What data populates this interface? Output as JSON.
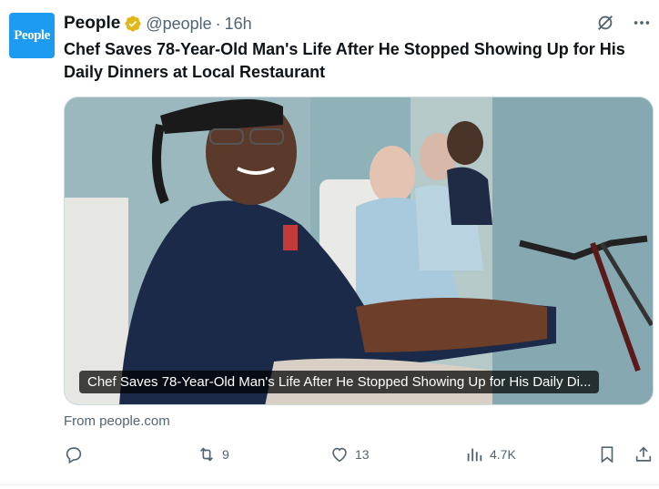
{
  "author": {
    "name": "People",
    "handle": "@people",
    "separator": "·",
    "time": "16h",
    "avatar_text": "People",
    "verified_icon": "gold-verified-badge"
  },
  "post": {
    "title": "Chef Saves 78-Year-Old Man's Life After He Stopped Showing Up for His Daily Dinners at Local Restaurant",
    "media_caption": "Chef Saves 78-Year-Old Man's Life After He Stopped Showing Up for His Daily Di...",
    "source": "From people.com"
  },
  "actions": {
    "reply_count": "",
    "repost_count": "9",
    "like_count": "13",
    "views_count": "4.7K"
  },
  "colors": {
    "brand": "#1d9bf0",
    "verified_gold": "#e2b719",
    "muted": "#536471"
  }
}
